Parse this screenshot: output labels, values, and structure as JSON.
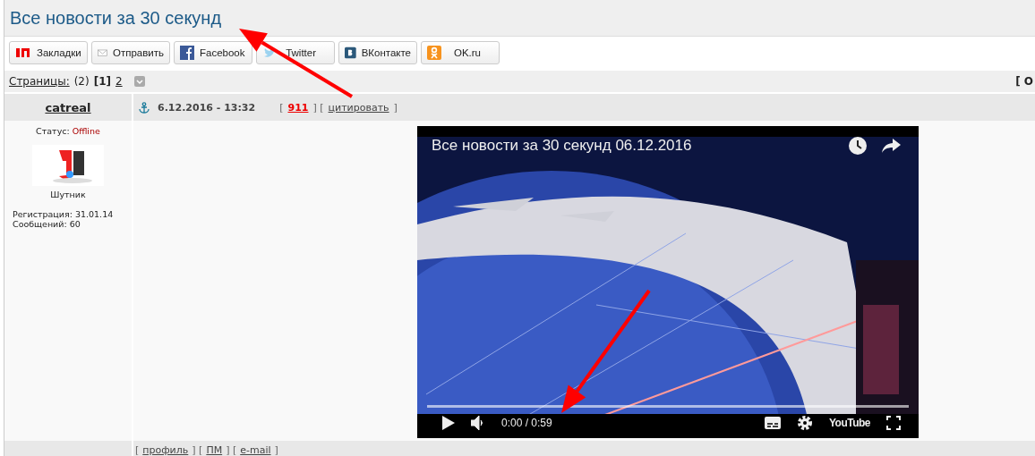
{
  "page_title": "Все новости за 30 секунд",
  "share_buttons": [
    {
      "kind": "yandex",
      "label": "Закладки"
    },
    {
      "kind": "mail",
      "label": "Отправить"
    },
    {
      "kind": "facebook",
      "label": "Facebook"
    },
    {
      "kind": "twitter",
      "label": "Twitter"
    },
    {
      "kind": "vk",
      "label": "ВКонтакте"
    },
    {
      "kind": "ok",
      "label": "OK.ru"
    }
  ],
  "pages": {
    "label": "Страницы:",
    "count": "(2)",
    "items": [
      {
        "text": "[1]",
        "selected": true
      },
      {
        "text": "2",
        "selected": false
      }
    ],
    "right_text": "[ О"
  },
  "post": {
    "author": "catreal",
    "date": "6.12.2016 - 13:32",
    "header_parts": [
      {
        "kind": "bracket",
        "text": "["
      },
      {
        "kind": "number",
        "text": "911"
      },
      {
        "kind": "bracket",
        "text": "] ["
      },
      {
        "kind": "link",
        "text": "цитировать"
      },
      {
        "kind": "bracket",
        "text": "]"
      }
    ],
    "status_label": "Статус:",
    "status": "Offline",
    "rank": "Шутник",
    "registration": "Регистрация: 31.01.14",
    "messages": "Сообщений: 60",
    "video": {
      "title": "Все новости за 30 секунд 06.12.2016",
      "time": "0:00 / 0:59",
      "logo": "YouTube",
      "level": 0
    },
    "footer_parts": [
      {
        "kind": "bracket",
        "text": "["
      },
      {
        "kind": "link",
        "text": "профиль"
      },
      {
        "kind": "bracket",
        "text": "] ["
      },
      {
        "kind": "link",
        "text": "ПМ"
      },
      {
        "kind": "bracket",
        "text": "] ["
      },
      {
        "kind": "link",
        "text": "e-mail"
      },
      {
        "kind": "bracket",
        "text": "]"
      }
    ]
  },
  "annotations": [
    {
      "kind": "arrow"
    },
    {
      "kind": "arrow"
    }
  ]
}
